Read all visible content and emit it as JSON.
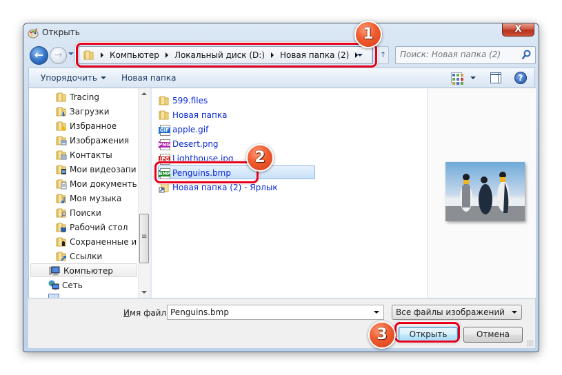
{
  "window": {
    "title": "Открыть",
    "close_label": "X"
  },
  "navigation": {
    "back_label": "←",
    "forward_label": "→",
    "breadcrumbs": [
      "Компьютер",
      "Локальный диск (D:)",
      "Новая папка (2)"
    ],
    "refresh_label": "↑"
  },
  "search": {
    "placeholder": "Поиск: Новая папка (2)"
  },
  "toolbar": {
    "organize_label": "Упорядочить",
    "new_folder_label": "Новая папка",
    "help_label": "?"
  },
  "sidebar": {
    "items": [
      {
        "label": "Tracing",
        "icon": "folder-icon"
      },
      {
        "label": "Загрузки",
        "icon": "downloads-folder-icon"
      },
      {
        "label": "Избранное",
        "icon": "favorites-folder-icon"
      },
      {
        "label": "Изображения",
        "icon": "pictures-folder-icon"
      },
      {
        "label": "Контакты",
        "icon": "contacts-folder-icon"
      },
      {
        "label": "Мои видеозаписи",
        "icon": "videos-folder-icon"
      },
      {
        "label": "Мои документы",
        "icon": "documents-folder-icon"
      },
      {
        "label": "Моя музыка",
        "icon": "music-folder-icon"
      },
      {
        "label": "Поиски",
        "icon": "searches-folder-icon"
      },
      {
        "label": "Рабочий стол",
        "icon": "desktop-folder-icon"
      },
      {
        "label": "Сохраненные игры",
        "icon": "saved-games-folder-icon"
      },
      {
        "label": "Ссылки",
        "icon": "links-folder-icon"
      },
      {
        "label": "Компьютер",
        "icon": "computer-icon",
        "selected": true
      },
      {
        "label": "Сеть",
        "icon": "network-icon"
      }
    ]
  },
  "files": {
    "items": [
      {
        "name": "599.files",
        "type": "folder"
      },
      {
        "name": "Новая папка",
        "type": "folder"
      },
      {
        "name": "apple.gif",
        "type": "GIF",
        "badge_color": "#1f6fd1"
      },
      {
        "name": "Desert.png",
        "type": "PNG",
        "badge_color": "#b020b0"
      },
      {
        "name": "Lighthouse.jpg",
        "type": "JPG",
        "badge_color": "#d01818"
      },
      {
        "name": "Penguins.bmp",
        "type": "BMP",
        "badge_color": "#1a8a2a",
        "selected": true
      },
      {
        "name": "Новая папка (2) - Ярлык",
        "type": "shortcut"
      }
    ]
  },
  "preview": {
    "alt": "Penguins preview"
  },
  "bottom": {
    "filename_label_u": "И",
    "filename_label_rest": "мя файла:",
    "filename_value": "Penguins.bmp",
    "filetype_value": "Все файлы изображений",
    "open_label": "Открыть",
    "cancel_label": "Отмена"
  },
  "annotations": {
    "step1": "1",
    "step2": "2",
    "step3": "3",
    "highlight_color": "#e4001b"
  }
}
